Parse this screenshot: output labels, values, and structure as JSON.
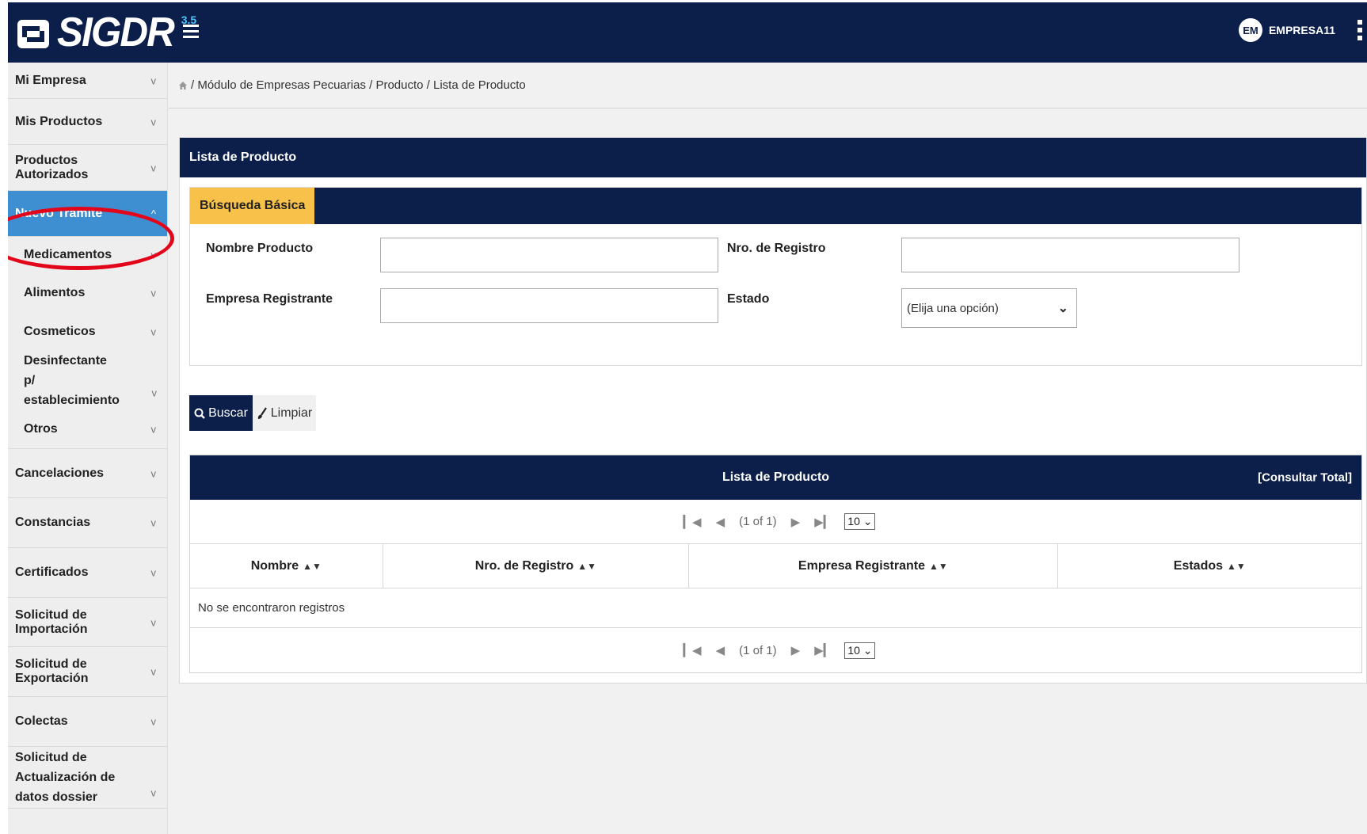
{
  "app": {
    "logo_text": "SIGDR",
    "logo_sup": "3.5",
    "username": "EMPRESA11",
    "avatar_initials": "EM"
  },
  "sidebar": {
    "items": [
      {
        "label": "Mi Empresa",
        "chevron": "v"
      },
      {
        "label": "Mis Productos",
        "chevron": "v"
      },
      {
        "label": "Productos Autorizados",
        "chevron": "v"
      },
      {
        "label": "Nuevo Trámite",
        "chevron": "^",
        "active": true
      },
      {
        "label": "Cancelaciones",
        "chevron": "v"
      },
      {
        "label": "Constancias",
        "chevron": "v"
      },
      {
        "label": "Certificados",
        "chevron": "v"
      },
      {
        "label": "Solicitud de Importación",
        "chevron": "v"
      },
      {
        "label": "Solicitud de Exportación",
        "chevron": "v"
      },
      {
        "label": "Colectas",
        "chevron": "v"
      },
      {
        "label": "Solicitud de Actualización de datos dossier",
        "chevron": "v"
      }
    ],
    "subitems": [
      {
        "label": "Medicamentos",
        "chevron": "v"
      },
      {
        "label": "Alimentos",
        "chevron": "v"
      },
      {
        "label": "Cosmeticos",
        "chevron": "v"
      },
      {
        "label": "Desinfectante p/ establecimiento",
        "chevron": "v"
      },
      {
        "label": "Otros",
        "chevron": "v"
      }
    ]
  },
  "breadcrumb": {
    "text": "/ Módulo de Empresas Pecuarias / Producto / Lista de Producto"
  },
  "panel": {
    "title": "Lista de Producto",
    "search_tab": "Búsqueda Básica",
    "fields": {
      "nombre_label": "Nombre Producto",
      "nombre_value": "",
      "registro_label": "Nro. de Registro",
      "registro_value": "",
      "empresa_label": "Empresa Registrante",
      "empresa_value": "",
      "estado_label": "Estado",
      "estado_value": "(Elija una opción)"
    },
    "buttons": {
      "buscar": "Buscar",
      "limpiar": "Limpiar"
    }
  },
  "table": {
    "title": "Lista de Producto",
    "consultar": "[Consultar Total]",
    "paginator_report": "(1 of 1)",
    "rows_per_page": "10",
    "columns": [
      "Nombre",
      "Nro. de Registro",
      "Empresa Registrante",
      "Estados"
    ],
    "empty_message": "No se encontraron registros"
  },
  "colors": {
    "navy": "#0c1f4a",
    "active_blue": "#3d8fd1",
    "tab_yellow": "#f7c14a",
    "highlight_red": "#e3061b"
  }
}
